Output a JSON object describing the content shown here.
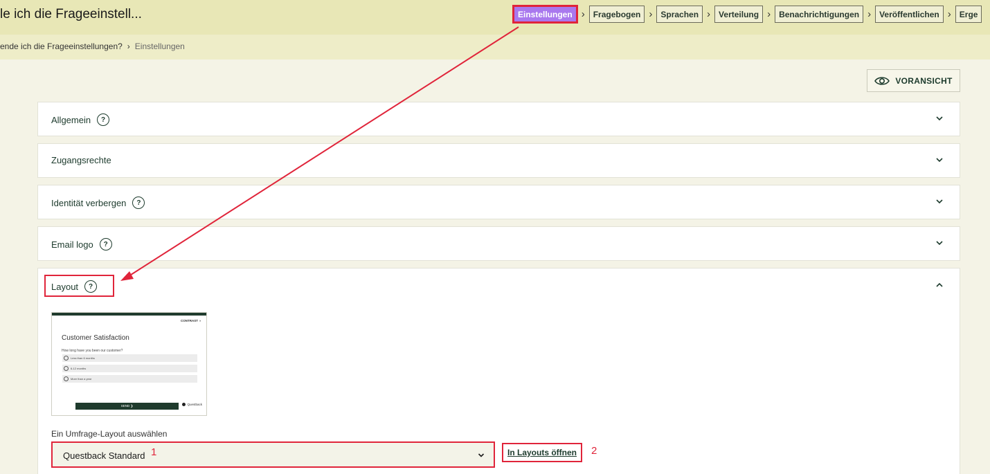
{
  "header": {
    "title": "le ich die Frageeinstell...",
    "steps": [
      "Einstellungen",
      "Fragebogen",
      "Sprachen",
      "Verteilung",
      "Benachrichtigungen",
      "Veröffentlichen",
      "Erge"
    ],
    "active_step": "Einstellungen"
  },
  "breadcrumb": {
    "parent": "ende ich die Frageeinstellungen?",
    "separator": "›",
    "current": "Einstellungen"
  },
  "preview_button": {
    "label": "VORANSICHT",
    "icon": "eye-icon"
  },
  "sections": [
    {
      "label": "Allgemein",
      "help": true,
      "help_symbol": "?"
    },
    {
      "label": "Zugangsrechte",
      "help": false
    },
    {
      "label": "Identität verbergen",
      "help": true,
      "help_symbol": "?"
    },
    {
      "label": "Email logo",
      "help": true,
      "help_symbol": "?"
    }
  ],
  "layout_section": {
    "label": "Layout",
    "help_symbol": "?",
    "expanded": true,
    "thumbnail": {
      "brand": "CONTRAST ◑",
      "title": "Customer Satisfaction",
      "question": "How long have you been our customer?",
      "options": [
        "Less than 6 months",
        "6-12 months",
        "More than a year"
      ],
      "send": "SEND ❯",
      "logo": "Questback"
    },
    "select_label": "Ein Umfrage-Layout auswählen",
    "select_value": "Questback Standard",
    "open_link": "In Layouts öffnen"
  },
  "annotations": {
    "marker_1": "1",
    "marker_2": "2",
    "color": "#e0243a"
  },
  "colors": {
    "topbar": "#e8e7b6",
    "background": "#f4f3e6",
    "active_step": "#a978ee",
    "text_dark_green": "#1c3a2c"
  }
}
